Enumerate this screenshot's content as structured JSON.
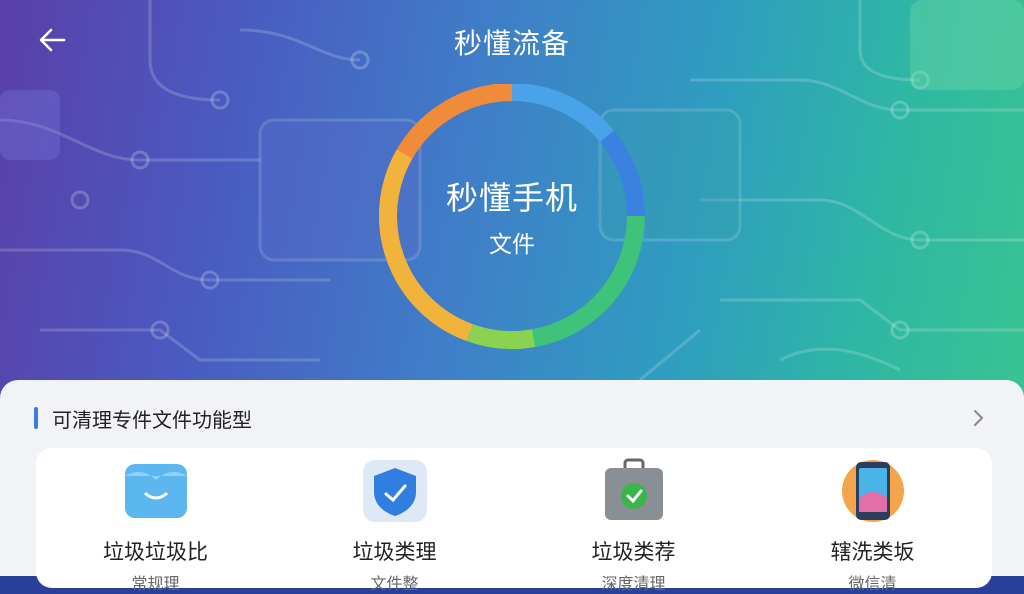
{
  "header": {
    "title": "秒懂流备"
  },
  "ring": {
    "main": "秒懂手机",
    "sub": "文件",
    "colors": [
      "#e8684a",
      "#4aa3e8",
      "#3b82e0",
      "#3fc27a",
      "#8ad24f",
      "#f2b33d",
      "#f08b3a"
    ]
  },
  "section": {
    "title": "可清理专件文件功能型"
  },
  "tools": [
    {
      "name": "垃圾垃圾比",
      "sub": "常规理",
      "icon": "blue-box-icon"
    },
    {
      "name": "垃圾类理",
      "sub": "文件整",
      "icon": "shield-tool-icon"
    },
    {
      "name": "垃圾类荐",
      "sub": "深度清理",
      "icon": "briefcase-check-icon"
    },
    {
      "name": "辖洗类坂",
      "sub": "微信清",
      "icon": "phone-icon"
    }
  ]
}
